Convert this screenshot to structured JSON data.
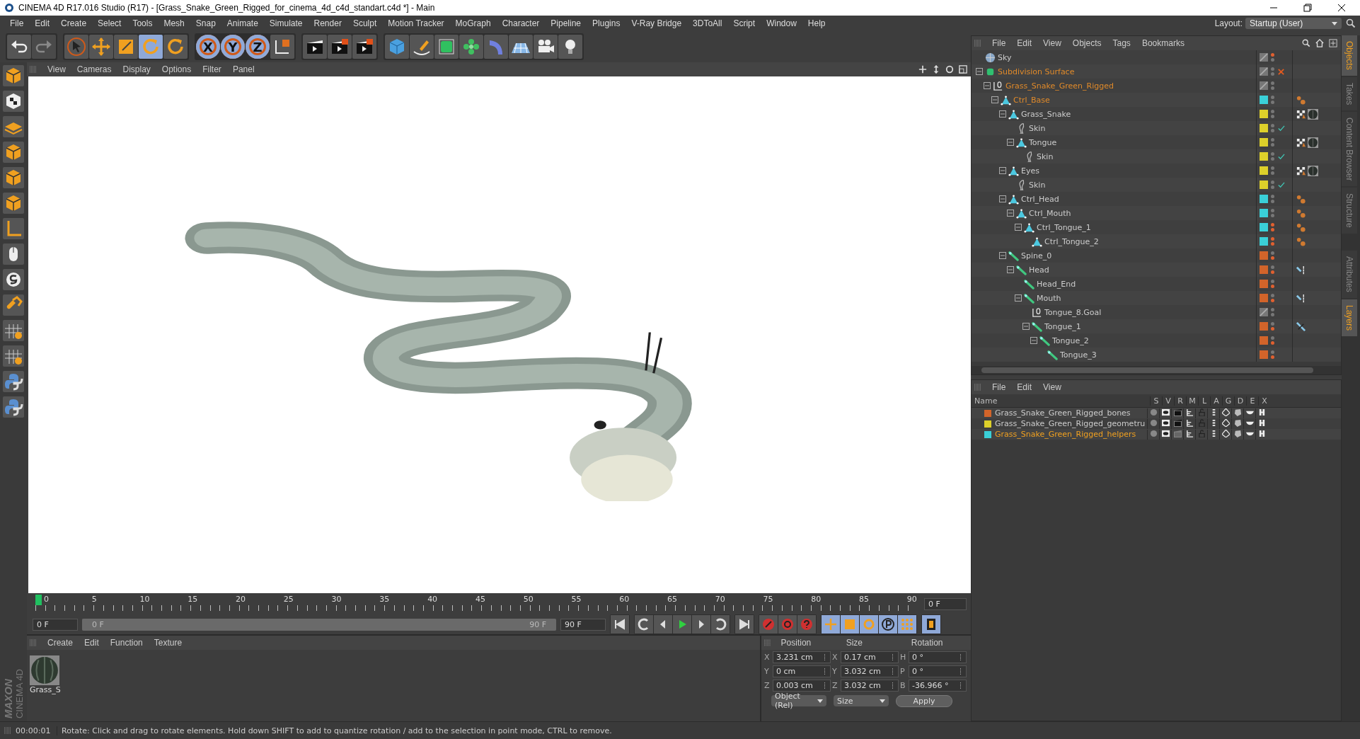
{
  "window": {
    "title": "CINEMA 4D R17.016 Studio (R17) - [Grass_Snake_Green_Rigged_for_cinema_4d_c4d_standart.c4d *] - Main"
  },
  "menu": [
    "File",
    "Edit",
    "Create",
    "Select",
    "Tools",
    "Mesh",
    "Snap",
    "Animate",
    "Simulate",
    "Render",
    "Sculpt",
    "Motion Tracker",
    "MoGraph",
    "Character",
    "Pipeline",
    "Plugins",
    "V-Ray Bridge",
    "3DToAll",
    "Script",
    "Window",
    "Help"
  ],
  "layout": {
    "label": "Layout:",
    "value": "Startup (User)"
  },
  "tools": [
    {
      "kind": "select",
      "selected": false
    },
    {
      "kind": "move",
      "selected": false
    },
    {
      "kind": "scale",
      "selected": false
    },
    {
      "kind": "rotate",
      "selected": true
    },
    {
      "kind": "rotate",
      "selected": false
    }
  ],
  "axis_locks": [
    {
      "label": "X",
      "selected": true
    },
    {
      "label": "Y",
      "selected": true
    },
    {
      "label": "Z",
      "selected": true
    }
  ],
  "viewport": {
    "menu": [
      "View",
      "Cameras",
      "Display",
      "Options",
      "Filter",
      "Panel"
    ]
  },
  "object_manager": {
    "menu": [
      "File",
      "Edit",
      "View",
      "Objects",
      "Tags",
      "Bookmarks"
    ],
    "objects": [
      {
        "name": "Sky",
        "kind": "sky",
        "selected": false,
        "editor_dot": true,
        "render_dot": false
      },
      {
        "name": "Subdivision Surface",
        "kind": "subdivision",
        "selected": true,
        "editor_dot": false,
        "render_dot": false,
        "flag": {
          "kind": "cross"
        },
        "children": [
          {
            "name": "Grass_Snake_Green_Rigged",
            "kind": "null",
            "selected": true,
            "editor_dot": false,
            "render_dot": false,
            "children": [
              {
                "name": "Ctrl_Base",
                "kind": "polygon",
                "selected": true,
                "color": "#3ad0d8",
                "editor_dot": false,
                "render_dot": false,
                "tags": [
                  {
                    "kind": "constraint"
                  }
                ],
                "children": [
                  {
                    "name": "Grass_Snake",
                    "kind": "polygon",
                    "selected": false,
                    "color": "#ddd02a",
                    "editor_dot": false,
                    "render_dot": false,
                    "tags": [
                      {
                        "kind": "texture"
                      },
                      {
                        "kind": "material"
                      }
                    ],
                    "children": [
                      {
                        "name": "Skin",
                        "kind": "skin",
                        "selected": false,
                        "color": "#ddd02a",
                        "editor_dot": false,
                        "render_dot": false,
                        "flag": {
                          "kind": "check"
                        }
                      },
                      {
                        "name": "Tongue",
                        "kind": "polygon",
                        "selected": false,
                        "color": "#ddd02a",
                        "editor_dot": false,
                        "render_dot": false,
                        "tags": [
                          {
                            "kind": "texture"
                          },
                          {
                            "kind": "material"
                          }
                        ],
                        "children": [
                          {
                            "name": "Skin",
                            "kind": "skin",
                            "selected": false,
                            "color": "#ddd02a",
                            "editor_dot": false,
                            "render_dot": false,
                            "flag": {
                              "kind": "check"
                            }
                          }
                        ]
                      }
                    ]
                  },
                  {
                    "name": "Eyes",
                    "kind": "polygon",
                    "selected": false,
                    "color": "#ddd02a",
                    "editor_dot": false,
                    "render_dot": false,
                    "tags": [
                      {
                        "kind": "texture"
                      },
                      {
                        "kind": "material"
                      }
                    ],
                    "children": [
                      {
                        "name": "Skin",
                        "kind": "skin",
                        "selected": false,
                        "color": "#ddd02a",
                        "editor_dot": false,
                        "render_dot": false,
                        "flag": {
                          "kind": "check"
                        }
                      }
                    ]
                  },
                  {
                    "name": "Ctrl_Head",
                    "kind": "polygon",
                    "selected": false,
                    "color": "#3ad0d8",
                    "editor_dot": false,
                    "render_dot": false,
                    "tags": [
                      {
                        "kind": "constraint"
                      }
                    ],
                    "children": [
                      {
                        "name": "Ctrl_Mouth",
                        "kind": "polygon",
                        "selected": false,
                        "color": "#3ad0d8",
                        "editor_dot": false,
                        "render_dot": false,
                        "tags": [
                          {
                            "kind": "constraint"
                          }
                        ],
                        "children": [
                          {
                            "name": "Ctrl_Tongue_1",
                            "kind": "polygon",
                            "selected": false,
                            "color": "#3ad0d8",
                            "editor_dot": true,
                            "render_dot": true,
                            "tags": [
                              {
                                "kind": "constraint"
                              }
                            ],
                            "children": [
                              {
                                "name": "Ctrl_Tongue_2",
                                "kind": "polygon",
                                "selected": false,
                                "color": "#3ad0d8",
                                "editor_dot": true,
                                "render_dot": true,
                                "tags": [
                                  {
                                    "kind": "constraint"
                                  }
                                ]
                              }
                            ]
                          }
                        ]
                      }
                    ]
                  },
                  {
                    "name": "Spine_0",
                    "kind": "joint",
                    "selected": false,
                    "color": "#d2642a",
                    "editor_dot": false,
                    "render_dot": true,
                    "children": [
                      {
                        "name": "Head",
                        "kind": "joint",
                        "selected": false,
                        "color": "#d2642a",
                        "editor_dot": false,
                        "render_dot": true,
                        "tags": [
                          {
                            "kind": "psr"
                          }
                        ],
                        "children": [
                          {
                            "name": "Head_End",
                            "kind": "joint",
                            "selected": false,
                            "color": "#d2642a",
                            "editor_dot": false,
                            "render_dot": true
                          },
                          {
                            "name": "Mouth",
                            "kind": "joint",
                            "selected": false,
                            "color": "#d2642a",
                            "editor_dot": false,
                            "render_dot": true,
                            "tags": [
                              {
                                "kind": "psr"
                              }
                            ],
                            "children": [
                              {
                                "name": "Tongue_8.Goal",
                                "kind": "null",
                                "selected": false,
                                "editor_dot": false,
                                "render_dot": false
                              },
                              {
                                "name": "Tongue_1",
                                "kind": "joint",
                                "selected": false,
                                "color": "#d2642a",
                                "editor_dot": false,
                                "render_dot": true,
                                "tags": [
                                  {
                                    "kind": "ik"
                                  }
                                ],
                                "children": [
                                  {
                                    "name": "Tongue_2",
                                    "kind": "joint",
                                    "selected": false,
                                    "color": "#d2642a",
                                    "editor_dot": false,
                                    "render_dot": true,
                                    "children": [
                                      {
                                        "name": "Tongue_3",
                                        "kind": "joint",
                                        "selected": false,
                                        "color": "#d2642a",
                                        "editor_dot": false,
                                        "render_dot": true
                                      }
                                    ]
                                  }
                                ]
                              }
                            ]
                          }
                        ]
                      }
                    ]
                  }
                ]
              }
            ]
          }
        ]
      }
    ]
  },
  "layer_manager": {
    "menu": [
      "File",
      "Edit",
      "View"
    ],
    "columns": [
      "Name",
      "S",
      "V",
      "R",
      "M",
      "L",
      "A",
      "G",
      "D",
      "E",
      "X"
    ],
    "layers": [
      {
        "name": "Grass_Snake_Green_Rigged_bones",
        "color": "#d2642a",
        "selected": false,
        "render": true
      },
      {
        "name": "Grass_Snake_Green_Rigged_geometru",
        "color": "#ddd02a",
        "selected": false,
        "render": true
      },
      {
        "name": "Grass_Snake_Green_Rigged_helpers",
        "color": "#3ad0d8",
        "selected": true,
        "render": false
      }
    ]
  },
  "side_tabs_top": [
    {
      "label": "Objects",
      "selected": true
    },
    {
      "label": "Takes",
      "selected": false
    },
    {
      "label": "Content Browser",
      "selected": false
    },
    {
      "label": "Structure",
      "selected": false
    }
  ],
  "side_tabs_bottom": [
    {
      "label": "Attributes",
      "selected": false
    },
    {
      "label": "Layers",
      "selected": true
    }
  ],
  "timeline": {
    "ticks": [
      "0",
      "5",
      "10",
      "15",
      "20",
      "25",
      "30",
      "35",
      "40",
      "45",
      "50",
      "55",
      "60",
      "65",
      "70",
      "75",
      "80",
      "85",
      "90"
    ],
    "current": "0 F",
    "start": "0 F",
    "range_start": "0 F",
    "range_end": "90 F",
    "level": 1,
    "end": "90 F"
  },
  "material_manager": {
    "menu": [
      "Create",
      "Edit",
      "Function",
      "Texture"
    ],
    "materials": [
      {
        "name": "Grass_S"
      }
    ]
  },
  "coordinates": {
    "headers": [
      "Position",
      "Size",
      "Rotation"
    ],
    "rows": [
      [
        {
          "axis": "X",
          "value": "3.231 cm"
        },
        {
          "axis": "X",
          "value": "0.17 cm"
        },
        {
          "axis": "H",
          "value": "0 °"
        }
      ],
      [
        {
          "axis": "Y",
          "value": "0 cm"
        },
        {
          "axis": "Y",
          "value": "3.032 cm"
        },
        {
          "axis": "P",
          "value": "0 °"
        }
      ],
      [
        {
          "axis": "Z",
          "value": "0.003 cm"
        },
        {
          "axis": "Z",
          "value": "3.032 cm"
        },
        {
          "axis": "B",
          "value": "-36.966 °"
        }
      ]
    ],
    "dropdowns": [
      "Object (Rel)",
      "Size"
    ],
    "apply": "Apply"
  },
  "logo": {
    "brand": "MAXON",
    "product": "CINEMA 4D"
  },
  "status_bar": {
    "time": "00:00:01",
    "message": "Rotate: Click and drag to rotate elements. Hold down SHIFT to add to quantize rotation / add to the selection in point mode, CTRL to remove."
  }
}
